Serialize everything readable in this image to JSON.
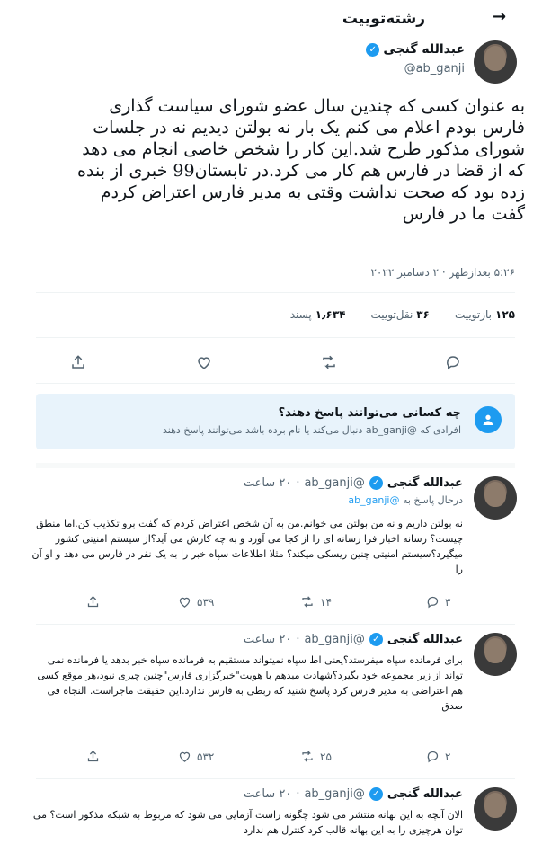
{
  "header": {
    "title": "رشته‌توییت",
    "back_icon": "arrow-icon"
  },
  "tweet": {
    "author_name": "عبدالله گنجی",
    "author_handle": "@ab_ganji",
    "text": "به عنوان کسی که چندین سال عضو شورای سیاست گذاری فارس بودم اعلام می کنم یک بار نه بولتن دیدیم نه در جلسات شورای مذکور طرح شد.این کار را شخص خاصی انجام می دهد که از قضا در فارس هم کار می کرد.در تابستان99 خبری از بنده زده بود که صحت نداشت وقتی به مدیر فارس اعتراض کردم گفت ما در فارس",
    "timestamp": "۵:۲۶ بعدازظهر · ۲ دسامبر ۲۰۲۲",
    "stats": [
      {
        "num": "۱۲۵",
        "label": "بازتوییت"
      },
      {
        "num": "۳۶",
        "label": "نقل‌توییت"
      },
      {
        "num": "۱٫۶۳۴",
        "label": "پسند"
      }
    ]
  },
  "who_can_reply": {
    "title": "چه کسانی می‌توانند پاسخ دهند؟",
    "subtitle": "افرادی که @ab_ganji دنبال می‌کند یا نام برده باشد می‌توانند پاسخ دهند"
  },
  "replies": [
    {
      "name": "عبدالله گنجی",
      "handle": "@ab_ganji",
      "time": "۲۰ ساعت",
      "replying_prefix": "درحال پاسخ به",
      "replying_to": "@ab_ganji",
      "text": "نه بولتن داریم و نه من بولتن می خوانم.من به آن شخص اعتراض کردم که گفت برو تکذیب کن.اما منطق چیست؟ رسانه اخبار فرا رسانه ای را از کجا می آورد و به چه کارش می آید؟از سیستم امنیتی کشور میگیرد؟سیستم امنیتی چنین ریسکی میکند؟ مثلا اطلاعات سپاه خبر را به یک نفر در فارس می دهد و او آن را",
      "replies": "۳",
      "retweets": "۱۴",
      "likes": "۵۳۹"
    },
    {
      "name": "عبدالله گنجی",
      "handle": "@ab_ganji",
      "time": "۲۰ ساعت",
      "text": "برای فرمانده سپاه میفرستد؟یعنی اط سپاه نمیتواند مستقیم به فرمانده سپاه خبر بدهد یا فرمانده نمی تواند از زیر مجموعه خود بگیرد؟شهادت میدهم با هویت\"خبرگزاری فارس\"چنین چیزی نبود،هر موقع کسی هم اعتراضی به مدیر فارس کرد پاسخ شنید که ربطی به فارس ندارد.این حقیقت ماجراست. النجاه فی صدق",
      "replies": "۲",
      "retweets": "۲۵",
      "likes": "۵۳۲"
    },
    {
      "name": "عبدالله گنجی",
      "handle": "@ab_ganji",
      "time": "۲۰ ساعت",
      "text": "الان آنچه به این بهانه منتشر می شود چگونه راست آزمایی می شود که مربوط به شبکه مذکور است؟ می توان هرچیزی را به این بهانه قالب کرد کنترل هم ندارد"
    }
  ]
}
